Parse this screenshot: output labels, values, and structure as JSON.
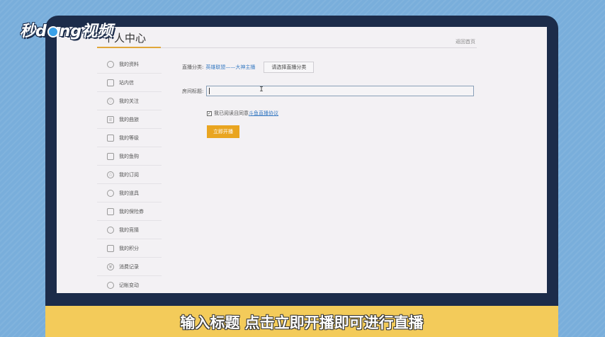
{
  "overlay": {
    "logo_text_1": "秒d",
    "logo_text_2": "ng视频",
    "subtitle": "输入标题 点击立即开播即可进行直播"
  },
  "header": {
    "title": "个人中心",
    "back_link": "返回首页"
  },
  "sidebar": {
    "items": [
      {
        "label": "我的资料",
        "icon": "user-circle-icon"
      },
      {
        "label": "站内信",
        "icon": "mail-icon"
      },
      {
        "label": "我的关注",
        "icon": "heart-icon"
      },
      {
        "label": "我的曲旅",
        "icon": "crown-icon"
      },
      {
        "label": "我的等级",
        "icon": "medal-icon"
      },
      {
        "label": "我的鱼购",
        "icon": "bag-icon"
      },
      {
        "label": "我的订阅",
        "icon": "star-icon"
      },
      {
        "label": "我的道具",
        "icon": "gift-icon"
      },
      {
        "label": "我的保险券",
        "icon": "ticket-icon"
      },
      {
        "label": "我的竞猜",
        "icon": "trophy-icon"
      },
      {
        "label": "我的积分",
        "icon": "points-icon"
      },
      {
        "label": "消费记录",
        "icon": "coin-icon"
      },
      {
        "label": "记帐变动",
        "icon": "record-icon"
      }
    ]
  },
  "form": {
    "category_label": "直播分类:",
    "category_value": "英雄联盟——大神主播",
    "choose_category_button": "请选择直播分类",
    "room_title_label": "房间标题:",
    "room_title_value": "",
    "agree_prefix": "我已阅读且同意",
    "agree_link": "斗鱼直播协议",
    "agree_checked": true,
    "start_button": "立即开播"
  }
}
